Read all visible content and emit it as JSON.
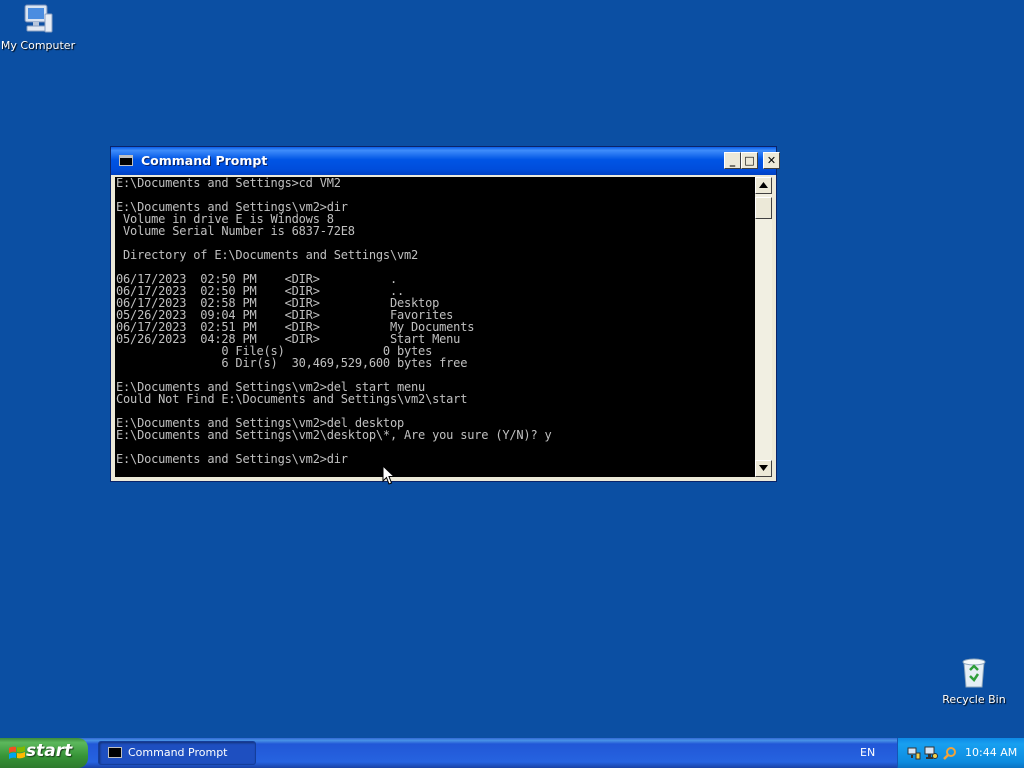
{
  "desktop": {
    "background_color": "#0b4fa3",
    "icons": [
      {
        "label": "My Computer",
        "icon": "my-computer-icon"
      },
      {
        "label": "Recycle Bin",
        "icon": "recycle-bin-icon"
      }
    ]
  },
  "cmd_window": {
    "title": "Command Prompt",
    "buttons": {
      "minimize": "_",
      "maximize": "□",
      "close": "✕"
    },
    "console_lines": [
      "E:\\Documents and Settings>cd VM2",
      "",
      "E:\\Documents and Settings\\vm2>dir",
      " Volume in drive E is Windows 8",
      " Volume Serial Number is 6837-72E8",
      "",
      " Directory of E:\\Documents and Settings\\vm2",
      "",
      "06/17/2023  02:50 PM    <DIR>          .",
      "06/17/2023  02:50 PM    <DIR>          ..",
      "06/17/2023  02:58 PM    <DIR>          Desktop",
      "05/26/2023  09:04 PM    <DIR>          Favorites",
      "06/17/2023  02:51 PM    <DIR>          My Documents",
      "05/26/2023  04:28 PM    <DIR>          Start Menu",
      "               0 File(s)              0 bytes",
      "               6 Dir(s)  30,469,529,600 bytes free",
      "",
      "E:\\Documents and Settings\\vm2>del start menu",
      "Could Not Find E:\\Documents and Settings\\vm2\\start",
      "",
      "E:\\Documents and Settings\\vm2>del desktop",
      "E:\\Documents and Settings\\vm2\\desktop\\*, Are you sure (Y/N)? y",
      "",
      "E:\\Documents and Settings\\vm2>dir"
    ]
  },
  "taskbar": {
    "start_label": "start",
    "tasks": [
      {
        "label": "Command Prompt",
        "icon": "command-prompt-icon"
      }
    ],
    "language": "EN",
    "clock": "10:44 AM"
  }
}
